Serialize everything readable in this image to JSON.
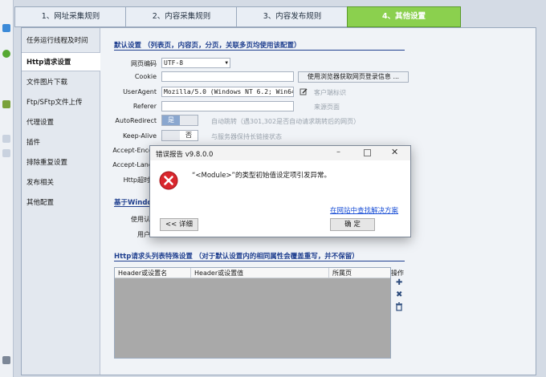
{
  "wizard": {
    "steps": [
      "1、网址采集规则",
      "2、内容采集规则",
      "3、内容发布规则",
      "4、其他设置"
    ],
    "active_step": 4
  },
  "sidebar": {
    "items": [
      {
        "label": "任务运行线程及时间",
        "active": false
      },
      {
        "label": "Http请求设置",
        "active": true
      },
      {
        "label": "文件图片下载",
        "active": false
      },
      {
        "label": "Ftp/SFtp文件上传",
        "active": false
      },
      {
        "label": "代理设置",
        "active": false
      },
      {
        "label": "插件",
        "active": false
      },
      {
        "label": "排除重复设置",
        "active": false
      },
      {
        "label": "发布相关",
        "active": false
      },
      {
        "label": "其他配置",
        "active": false
      }
    ]
  },
  "default_settings": {
    "title": "默认设置 （列表页，内容页，分页，关联多页均使用该配置）",
    "encoding_label": "网页编码",
    "encoding_value": "UTF-8",
    "cookie_label": "Cookie",
    "cookie_value": "",
    "cookie_button": "使用浏览器获取网页登录信息 ...",
    "useragent_label": "UserAgent",
    "useragent_value": "Mozilla/5.0 (Windows NT 6.2; Win64; x",
    "useragent_hint": "客户端标识",
    "referer_label": "Referer",
    "referer_value": "",
    "referer_hint": "来源页面",
    "autoredirect_label": "AutoRedirect",
    "autoredirect_on": "是",
    "autoredirect_hint": "自动跳转（遇301,302是否自动请求跳转后的网页）",
    "keepalive_label": "Keep-Alive",
    "keepalive_off": "否",
    "keepalive_hint": "与服务器保持长链接状态",
    "accept_encoding_label": "Accept-Encod",
    "accept_language_label": "Accept-Langu",
    "http_timeout_label": "Http超时时"
  },
  "windows_auth": {
    "title": "基于Window",
    "user_label": "使用认",
    "user2_label": "用户"
  },
  "header_table": {
    "title": "Http请求头列表特殊设置 （对于默认设置内的相同属性会覆盖重写，并不保留）",
    "columns": [
      "Header或设置名",
      "Header或设置值",
      "所属页"
    ],
    "rows": [],
    "ops_label": "操作"
  },
  "dialog": {
    "title": "错误报告 v9.8.0.0",
    "message": "“<Module>”的类型初始值设定项引发异常。",
    "link": "在网站中查找解决方案",
    "details_button": "<< 详细",
    "ok_button": "确 定"
  },
  "colors": {
    "active_step": "#8bd04e",
    "section_title": "#1f3f8f",
    "error_icon": "#d9262c",
    "link": "#1a4fd6"
  }
}
